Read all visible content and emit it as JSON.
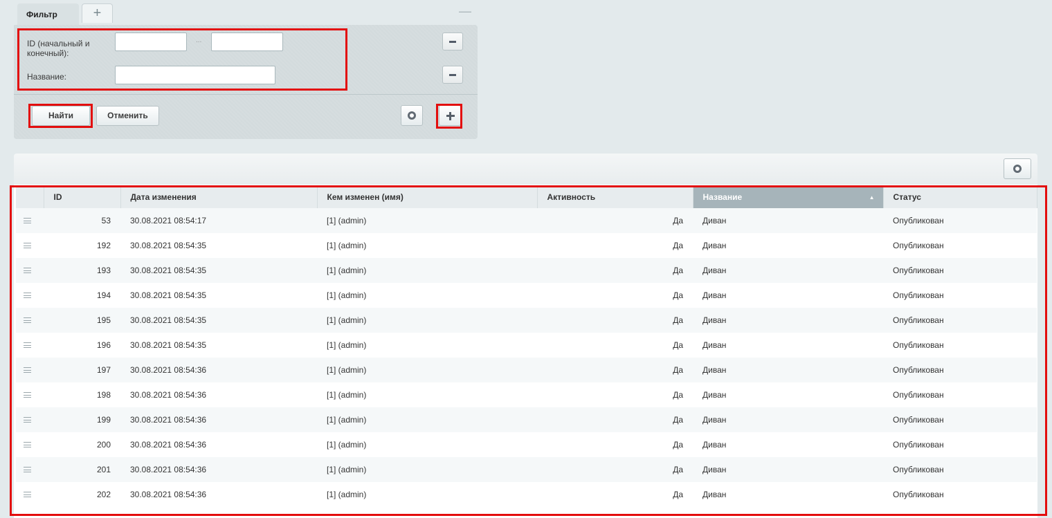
{
  "filter": {
    "tab_label": "Фильтр",
    "add_tab_label": "+",
    "collapse_label": "—",
    "id_label": "ID (начальный и конечный):",
    "id_range_dash": "...",
    "id_from_value": "",
    "id_to_value": "",
    "name_label": "Название:",
    "name_value": "",
    "find_label": "Найти",
    "cancel_label": "Отменить"
  },
  "grid": {
    "columns": [
      "",
      "ID",
      "Дата изменения",
      "Кем изменен (имя)",
      "Активность",
      "Название",
      "Статус"
    ],
    "sorted_column": "Название",
    "sort_direction": "asc",
    "rows": [
      {
        "id": "53",
        "date": "30.08.2021 08:54:17",
        "user": "[1] (admin)",
        "active": "Да",
        "name": "Диван",
        "status": "Опубликован"
      },
      {
        "id": "192",
        "date": "30.08.2021 08:54:35",
        "user": "[1] (admin)",
        "active": "Да",
        "name": "Диван",
        "status": "Опубликован"
      },
      {
        "id": "193",
        "date": "30.08.2021 08:54:35",
        "user": "[1] (admin)",
        "active": "Да",
        "name": "Диван",
        "status": "Опубликован"
      },
      {
        "id": "194",
        "date": "30.08.2021 08:54:35",
        "user": "[1] (admin)",
        "active": "Да",
        "name": "Диван",
        "status": "Опубликован"
      },
      {
        "id": "195",
        "date": "30.08.2021 08:54:35",
        "user": "[1] (admin)",
        "active": "Да",
        "name": "Диван",
        "status": "Опубликован"
      },
      {
        "id": "196",
        "date": "30.08.2021 08:54:35",
        "user": "[1] (admin)",
        "active": "Да",
        "name": "Диван",
        "status": "Опубликован"
      },
      {
        "id": "197",
        "date": "30.08.2021 08:54:36",
        "user": "[1] (admin)",
        "active": "Да",
        "name": "Диван",
        "status": "Опубликован"
      },
      {
        "id": "198",
        "date": "30.08.2021 08:54:36",
        "user": "[1] (admin)",
        "active": "Да",
        "name": "Диван",
        "status": "Опубликован"
      },
      {
        "id": "199",
        "date": "30.08.2021 08:54:36",
        "user": "[1] (admin)",
        "active": "Да",
        "name": "Диван",
        "status": "Опубликован"
      },
      {
        "id": "200",
        "date": "30.08.2021 08:54:36",
        "user": "[1] (admin)",
        "active": "Да",
        "name": "Диван",
        "status": "Опубликован"
      },
      {
        "id": "201",
        "date": "30.08.2021 08:54:36",
        "user": "[1] (admin)",
        "active": "Да",
        "name": "Диван",
        "status": "Опубликован"
      },
      {
        "id": "202",
        "date": "30.08.2021 08:54:36",
        "user": "[1] (admin)",
        "active": "Да",
        "name": "Диван",
        "status": "Опубликован"
      }
    ]
  },
  "icons": {
    "settings": "gear-icon",
    "add": "plus-icon",
    "remove": "minus-icon",
    "drag": "drag-handle-icon",
    "sort": "sort-ascending-icon"
  },
  "colors": {
    "highlight": "#e30d0d",
    "sorted_header": "#a6b4ba",
    "page_background": "#e3eaec"
  }
}
